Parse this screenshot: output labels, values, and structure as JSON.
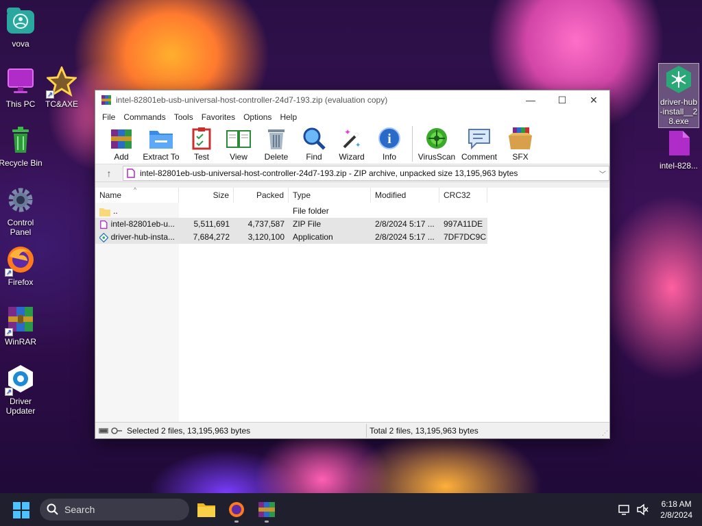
{
  "desktop": {
    "icons": [
      {
        "label": "vova"
      },
      {
        "label": "This PC"
      },
      {
        "label": "TC&AXE"
      },
      {
        "label": "Recycle Bin"
      },
      {
        "label": "Control Panel"
      },
      {
        "label": "Firefox"
      },
      {
        "label": "WinRAR"
      },
      {
        "label": "Driver Updater"
      },
      {
        "label": "driver-hub-install__28.exe"
      },
      {
        "label": "intel-828..."
      }
    ]
  },
  "window": {
    "title": "intel-82801eb-usb-universal-host-controller-24d7-193.zip (evaluation copy)",
    "menu": [
      "File",
      "Commands",
      "Tools",
      "Favorites",
      "Options",
      "Help"
    ],
    "toolbar": [
      "Add",
      "Extract To",
      "Test",
      "View",
      "Delete",
      "Find",
      "Wizard",
      "Info",
      "VirusScan",
      "Comment",
      "SFX"
    ],
    "address": "intel-82801eb-usb-universal-host-controller-24d7-193.zip - ZIP archive, unpacked size 13,195,963 bytes",
    "columns": [
      "Name",
      "Size",
      "Packed",
      "Type",
      "Modified",
      "CRC32"
    ],
    "rows": [
      {
        "name": "..",
        "size": "",
        "packed": "",
        "type": "File folder",
        "modified": "",
        "crc": ""
      },
      {
        "name": "intel-82801eb-u...",
        "size": "5,511,691",
        "packed": "4,737,587",
        "type": "ZIP File",
        "modified": "2/8/2024 5:17 ...",
        "crc": "997A11DE"
      },
      {
        "name": "driver-hub-insta...",
        "size": "7,684,272",
        "packed": "3,120,100",
        "type": "Application",
        "modified": "2/8/2024 5:17 ...",
        "crc": "7DF7DC9C"
      }
    ],
    "status_left": "Selected 2 files, 13,195,963 bytes",
    "status_right": "Total 2 files, 13,195,963 bytes"
  },
  "taskbar": {
    "search_placeholder": "Search",
    "time": "6:18 AM",
    "date": "2/8/2024"
  }
}
